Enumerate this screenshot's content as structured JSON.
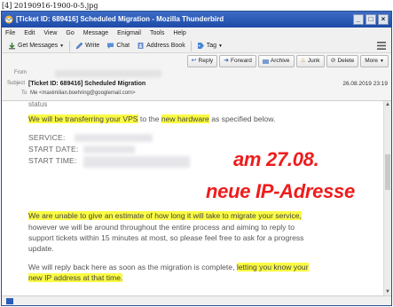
{
  "caption": "[4] 20190916-1900-0-5.jpg",
  "window": {
    "title": "[Ticket ID: 689416] Scheduled Migration - Mozilla Thunderbird",
    "controls": [
      "_",
      "□",
      "×"
    ]
  },
  "menu": [
    "File",
    "Edit",
    "View",
    "Go",
    "Message",
    "Enigmail",
    "Tools",
    "Help"
  ],
  "toolbar": {
    "get_messages": "Get Messages",
    "write": "Write",
    "chat": "Chat",
    "address_book": "Address Book",
    "tag": "Tag"
  },
  "actions": {
    "reply": "Reply",
    "forward": "Forward",
    "archive": "Archive",
    "junk": "Junk",
    "delete": "Delete",
    "more": "More"
  },
  "header": {
    "from_label": "From",
    "subject_label": "Subject",
    "subject": "[Ticket ID: 689416] Scheduled Migration",
    "date": "26.08.2019 23:19",
    "to_label": "To",
    "to": "Me <maximilian.boehring@googlemail.com>"
  },
  "body": {
    "cut_off_text": "status",
    "p1_a": "We will be transferring your VPS",
    "p1_b": " to the ",
    "p1_c": "new hardware",
    "p1_d": " as specified below.",
    "service_label": "SERVICE:",
    "start_date_label": "START DATE:",
    "start_time_label": "START TIME:",
    "p2_hl": "We are unable to give an estimate of how long it will take to migrate your service,",
    "p2_line2": "however we will be around throughout the entire process and aiming to reply to",
    "p2_line3": "support tickets within 15 minutes at most, so please feel free to ask for a progress",
    "p2_line4": "update.",
    "p3_line1_a": "We will reply back here as soon as the migration is complete, ",
    "p3_line1_hl": "letting you know your",
    "p3_line2_hl": "new IP address at that time."
  },
  "annotations": {
    "red1": "am 27.08.",
    "red2": "neue IP-Adresse"
  },
  "colors": {
    "titlebar": "#1d4aa8",
    "highlight": "#fbfb44",
    "annotation_red": "#ee1c1c"
  }
}
